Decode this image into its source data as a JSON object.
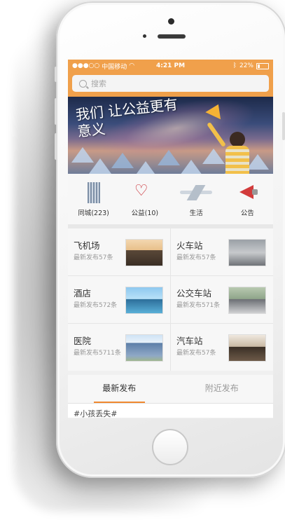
{
  "status_bar": {
    "signal": "●●●○○",
    "carrier": "中国移动",
    "time": "4:21 PM",
    "battery": "22%"
  },
  "search": {
    "placeholder": "搜索"
  },
  "banner": {
    "slogan": "我们 让公益更有意义"
  },
  "categories": [
    {
      "label": "同城(223)",
      "icon": "building-icon"
    },
    {
      "label": "公益(10)",
      "icon": "heart-ribbon-icon"
    },
    {
      "label": "生活",
      "icon": "airplane-icon"
    },
    {
      "label": "公告",
      "icon": "megaphone-icon"
    }
  ],
  "places": [
    {
      "title": "飞机场",
      "sub": "最新发布57条"
    },
    {
      "title": "火车站",
      "sub": "最新发布57条"
    },
    {
      "title": "酒店",
      "sub": "最新发布572条"
    },
    {
      "title": "公交车站",
      "sub": "最新发布571条"
    },
    {
      "title": "医院",
      "sub": "最新发布5711条"
    },
    {
      "title": "汽车站",
      "sub": "最新发布57条"
    }
  ],
  "tabs": [
    {
      "label": "最新发布",
      "active": true
    },
    {
      "label": "附近发布",
      "active": false
    }
  ],
  "feed": {
    "first_item_preview": "#小孩丢失#"
  },
  "colors": {
    "accent": "#f0a04b",
    "tab_underline": "#f0892f"
  }
}
